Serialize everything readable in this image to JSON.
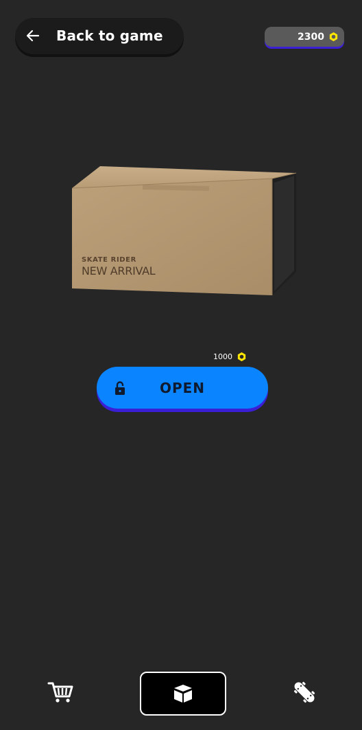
{
  "header": {
    "back_label": "Back to game",
    "balance": "2300"
  },
  "box": {
    "brand": "SKATE RIDER",
    "title": "NEW ARRIVAL"
  },
  "open": {
    "price": "1000",
    "label": "OPEN"
  },
  "nav": {
    "items": [
      {
        "icon": "cart-icon",
        "active": false
      },
      {
        "icon": "box-icon",
        "active": true
      },
      {
        "icon": "skateboard-icon",
        "active": false
      }
    ]
  },
  "colors": {
    "background": "#262626",
    "accent": "#0a84ff",
    "accent_shadow": "#3b1fd6",
    "coin": "#ffe600"
  }
}
